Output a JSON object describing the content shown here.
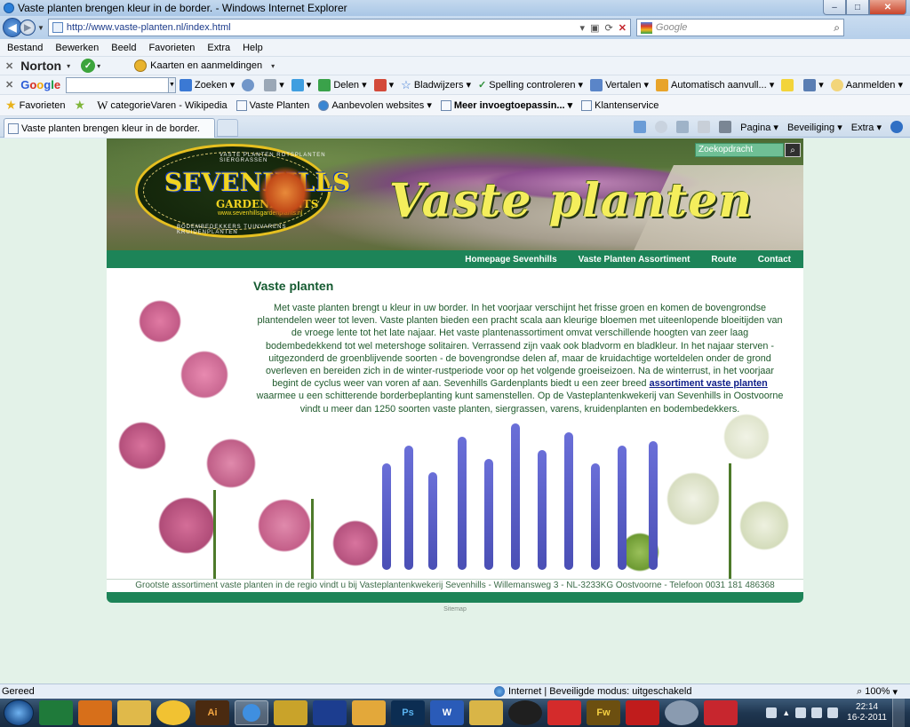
{
  "window": {
    "title": "Vaste planten brengen kleur in de border. - Windows Internet Explorer",
    "controls": {
      "minimize": "–",
      "maximize": "□",
      "close": "✕"
    }
  },
  "address_bar": {
    "url": "http://www.vaste-planten.nl/index.html",
    "search_placeholder": "Google"
  },
  "menu": {
    "items": [
      "Bestand",
      "Bewerken",
      "Beeld",
      "Favorieten",
      "Extra",
      "Help"
    ]
  },
  "norton_bar": {
    "logo": "Norton",
    "identity_label": "Kaarten en aanmeldingen"
  },
  "google_bar": {
    "logo_parts": [
      "G",
      "o",
      "o",
      "g",
      "l",
      "e"
    ],
    "search_label": "Zoeken",
    "share_label": "Delen",
    "bookmarks_label": "Bladwijzers",
    "spellcheck_label": "Spelling controleren",
    "translate_label": "Vertalen",
    "autofill_label": "Automatisch aanvull...",
    "signin_label": "Aanmelden"
  },
  "favorites_bar": {
    "favorites_label": "Favorieten",
    "items": [
      "categorieVaren - Wikipedia",
      "Vaste Planten",
      "Aanbevolen websites",
      "Meer invoegtoepassin...",
      "Klantenservice"
    ]
  },
  "tab": {
    "label": "Vaste planten brengen kleur in de border."
  },
  "command_bar": {
    "page_label": "Pagina",
    "security_label": "Beveiliging",
    "tools_label": "Extra"
  },
  "site": {
    "logo_brand": "SEVENHILLS",
    "logo_sub": "GARDENPLANTS",
    "logo_url": "www.sevenhillsgardenplants.nl",
    "logo_top_text": "VASTE PLANTEN  ROTSPLANTEN  SIERGRASSEN",
    "logo_bottom_text": "BODEMBEDEKKERS  TUINVARENS  KRUIDENPLANTEN",
    "header_title": "Vaste planten",
    "search_placeholder": "Zoekopdracht",
    "nav": [
      "Homepage Sevenhills",
      "Vaste Planten Assortiment",
      "Route",
      "Contact"
    ],
    "article_heading": "Vaste planten",
    "article_text_1": "Met vaste planten brengt u kleur in uw border. In het voorjaar verschijnt het frisse groen en komen de bovengrondse plantendelen weer tot leven. Vaste planten bieden een pracht scala aan kleurige bloemen met uiteenlopende bloeitijden van de vroege lente tot het late najaar. Het vaste plantenassortiment omvat verschillende hoogten van zeer laag bodembedekkend tot wel metershoge solitairen. Verrassend zijn vaak ook bladvorm en bladkleur. In het najaar sterven - uitgezonderd de groenblijvende soorten - de bovengrondse delen af, maar de kruidachtige worteldelen onder de grond overleven en bereiden zich in de winter-rustperiode voor op het volgende groeiseizoen. Na de winterrust, in het voorjaar begint de cyclus weer van voren af aan. Sevenhills Gardenplants biedt u een zeer breed",
    "article_link": "assortiment vaste planten",
    "article_text_2": "waarmee u een schitterende borderbeplanting kunt samenstellen. Op de Vasteplantenkwekerij van Sevenhills in Oostvoorne vindt u meer dan 1250 soorten vaste planten, siergrassen, varens, kruidenplanten en bodembedekkers.",
    "footer_text": "Grootste assortiment vaste planten in de regio vindt u bij Vasteplantenkwekerij Sevenhills - Willemansweg 3 - NL-3233KG Oostvoorne - Telefoon 0031 181 486368",
    "sitemap_label": "Sitemap"
  },
  "status_bar": {
    "status": "Gereed",
    "zone": "Internet | Beveiligde modus: uitgeschakeld",
    "zoom": "100%"
  },
  "taskbar": {
    "apps": [
      "excel",
      "media-player",
      "explorer",
      "messenger",
      "illustrator",
      "internet-explorer",
      "app-mail",
      "teletext",
      "outlook",
      "photoshop",
      "word",
      "folder",
      "hp",
      "paint-splash",
      "fireworks",
      "acrobat",
      "paint",
      "shop"
    ],
    "app_labels": {
      "illustrator": "Ai",
      "photoshop": "Ps",
      "fireworks": "Fw",
      "word": "W"
    },
    "time": "22:14",
    "date": "16-2-2011"
  },
  "colors": {
    "site_green": "#1d8458",
    "heading_green": "#145a30",
    "page_background": "#e3f2e8",
    "title_yellow": "#f4ee5c"
  }
}
